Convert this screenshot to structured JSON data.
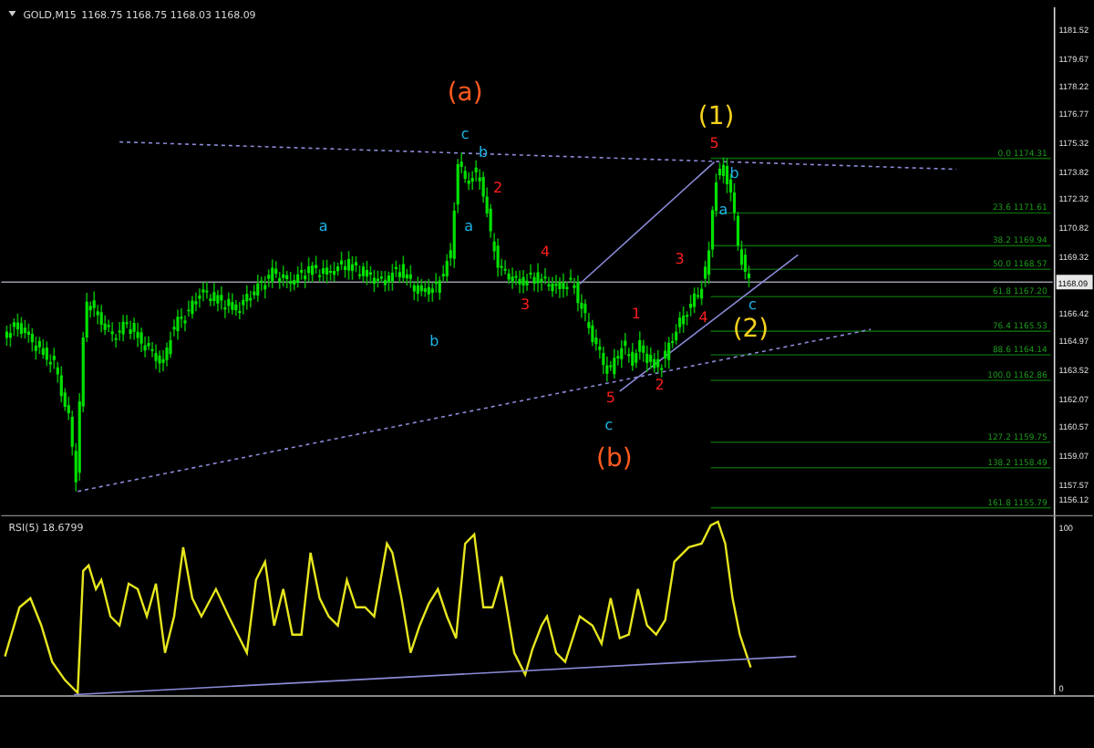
{
  "header": {
    "symbol": "GOLD,M15",
    "quotes": "1168.75 1168.75 1168.03 1168.09"
  },
  "price_axis": [
    "1181.52",
    "1179.67",
    "1178.22",
    "1176.77",
    "1175.32",
    "1173.82",
    "1172.32",
    "1170.82",
    "1169.32",
    "1166.42",
    "1164.97",
    "1163.52",
    "1162.07",
    "1160.57",
    "1159.07",
    "1157.57",
    "1156.12"
  ],
  "current_price": "1168.09",
  "fibonacci": [
    "0.0 1174.31",
    "23.6 1171.61",
    "38.2 1169.94",
    "50.0 1168.57",
    "61.8 1167.20",
    "76.4 1165.53",
    "88.6 1164.14",
    "100.0 1162.86",
    "127.2 1159.75",
    "138.2 1158.49",
    "161.8 1155.79"
  ],
  "wave_labels": [
    {
      "text": "(a)",
      "kind": "major",
      "color": "#ff5a1e"
    },
    {
      "text": "(b)",
      "kind": "major",
      "color": "#ff5a1e"
    },
    {
      "text": "(1)",
      "kind": "major",
      "color": "#f5d21e"
    },
    {
      "text": "(2)",
      "kind": "major",
      "color": "#f5d21e"
    },
    {
      "text": "a",
      "kind": "minor",
      "color": "#1eb4e6"
    },
    {
      "text": "b",
      "kind": "minor",
      "color": "#1eb4e6"
    },
    {
      "text": "c",
      "kind": "minor",
      "color": "#1eb4e6"
    },
    {
      "text": "b",
      "kind": "minor",
      "color": "#1eb4e6"
    },
    {
      "text": "a",
      "kind": "minor",
      "color": "#1eb4e6"
    },
    {
      "text": "2",
      "kind": "minor",
      "color": "#ff1e1e"
    },
    {
      "text": "3",
      "kind": "minor",
      "color": "#ff1e1e"
    },
    {
      "text": "4",
      "kind": "minor",
      "color": "#ff1e1e"
    },
    {
      "text": "5",
      "kind": "minor",
      "color": "#ff1e1e"
    },
    {
      "text": "c",
      "kind": "minor",
      "color": "#1eb4e6"
    },
    {
      "text": "1",
      "kind": "minor",
      "color": "#ff1e1e"
    },
    {
      "text": "2",
      "kind": "minor",
      "color": "#ff1e1e"
    },
    {
      "text": "3",
      "kind": "minor",
      "color": "#ff1e1e"
    },
    {
      "text": "4",
      "kind": "minor",
      "color": "#ff1e1e"
    },
    {
      "text": "5",
      "kind": "minor",
      "color": "#ff1e1e"
    },
    {
      "text": "b",
      "kind": "minor",
      "color": "#1eb4e6"
    },
    {
      "text": "a",
      "kind": "minor",
      "color": "#1eb4e6"
    },
    {
      "text": "c",
      "kind": "minor",
      "color": "#1eb4e6"
    }
  ],
  "rsi": {
    "label": "RSI(5) 18.6799",
    "axis": [
      "100",
      "0"
    ]
  }
}
